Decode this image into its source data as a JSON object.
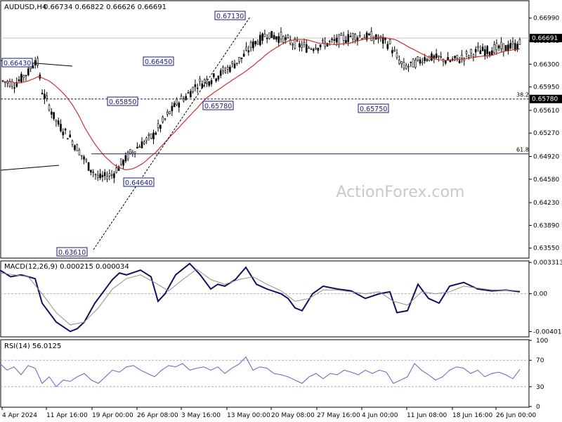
{
  "chart_data": [
    {
      "panel": "price",
      "type": "candlestick",
      "symbol": "AUDUSD,H4",
      "ohlc_text": "0.66734 0.66822 0.66626 0.66691",
      "watermark": "ActionForex.com",
      "ylim": [
        0.634,
        0.6725
      ],
      "y_ticks": [
        0.6635,
        0.6389,
        0.6423,
        0.6458,
        0.6492,
        0.6527,
        0.6561,
        0.6596,
        0.663,
        0.6665,
        0.6699
      ],
      "y_tick_labels": [
        "0.63550",
        "0.63890",
        "0.64230",
        "0.64580",
        "0.64920",
        "0.65270",
        "0.65610",
        "0.65950",
        "0.66300",
        "0.66640",
        "0.66990"
      ],
      "current_price": 0.66691,
      "current_price_label": "0.66691",
      "series": [
        {
          "name": "",
          "x": [
            0,
            20,
            40,
            52,
            60,
            80,
            100,
            125,
            140,
            160,
            180,
            200,
            215,
            230,
            250,
            265,
            280,
            300,
            320,
            345,
            360,
            380,
            400,
            420,
            440,
            460,
            480,
            500,
            520,
            540,
            555,
            565,
            575,
            590,
            605,
            620,
            640,
            660,
            680,
            700,
            720,
            740
          ],
          "y": [
            0.6606,
            0.66,
            0.6618,
            0.664,
            0.659,
            0.6545,
            0.652,
            0.648,
            0.646,
            0.6465,
            0.649,
            0.651,
            0.652,
            0.654,
            0.657,
            0.6582,
            0.66,
            0.6608,
            0.662,
            0.664,
            0.666,
            0.6675,
            0.667,
            0.666,
            0.6655,
            0.666,
            0.6665,
            0.6672,
            0.6672,
            0.6668,
            0.666,
            0.664,
            0.6625,
            0.663,
            0.664,
            0.664,
            0.6635,
            0.664,
            0.665,
            0.6652,
            0.6655,
            0.666
          ]
        }
      ],
      "moving_average": {
        "name": "",
        "color": "#d03030"
      },
      "labels": [
        {
          "text": "0.66430",
          "value": 0.6643
        },
        {
          "text": "0.66450",
          "value": 0.6645
        },
        {
          "text": "0.67130",
          "value": 0.6713
        },
        {
          "text": "0.65850",
          "value": 0.6585
        },
        {
          "text": "0.65780",
          "value": 0.6578
        },
        {
          "text": "0.65750",
          "value": 0.6575
        },
        {
          "text": "0.64640",
          "value": 0.6464
        },
        {
          "text": "0.63610",
          "value": 0.6361
        }
      ],
      "fib_levels": [
        {
          "text": "38.2",
          "value": 0.6578,
          "label": "0.65780"
        },
        {
          "text": "61.8",
          "value": 0.6496
        }
      ]
    },
    {
      "panel": "macd",
      "type": "line",
      "title": "MACD(12,26,9) 0.000215 0.000034",
      "ylim": [
        -0.0045,
        0.0034
      ],
      "y_tick_labels": [
        "0.003313",
        "0.00",
        "-0.004016"
      ],
      "y_ticks": [
        0.003313,
        0.0,
        -0.004016
      ],
      "series": [
        {
          "name": "",
          "color": "#101060",
          "x": [
            0,
            15,
            30,
            50,
            60,
            70,
            80,
            90,
            100,
            110,
            120,
            135,
            150,
            160,
            170,
            180,
            200,
            215,
            225,
            235,
            250,
            270,
            285,
            300,
            310,
            320,
            335,
            350,
            365,
            380,
            400,
            410,
            420,
            430,
            445,
            460,
            480,
            500,
            520,
            540,
            555,
            565,
            580,
            595,
            610,
            625,
            640,
            660,
            680,
            700,
            720,
            740
          ],
          "y": [
            0.0025,
            0.0018,
            0.002,
            0.0016,
            -0.001,
            -0.002,
            -0.003,
            -0.0035,
            -0.004,
            -0.0037,
            -0.003,
            -0.001,
            0.0005,
            0.0015,
            0.0022,
            0.002,
            0.0025,
            0.0018,
            -0.0008,
            0.0,
            0.002,
            0.0032,
            0.002,
            0.0005,
            0.001,
            0.0008,
            0.0015,
            0.0028,
            0.001,
            0.0005,
            0.0,
            -0.0005,
            -0.0015,
            -0.0018,
            0.0,
            0.0008,
            0.0005,
            0.0003,
            -0.0005,
            0.0,
            0.0002,
            -0.002,
            -0.0018,
            0.001,
            -0.0005,
            -0.001,
            0.0008,
            0.0012,
            0.0005,
            0.0003,
            0.0004,
            0.0002
          ]
        },
        {
          "name": "",
          "color": "#909090",
          "x": [
            0,
            20,
            40,
            60,
            80,
            100,
            120,
            140,
            160,
            180,
            200,
            220,
            240,
            260,
            280,
            300,
            320,
            340,
            360,
            380,
            400,
            420,
            440,
            460,
            480,
            500,
            520,
            540,
            560,
            580,
            600,
            620,
            640,
            660,
            680,
            700,
            720,
            740
          ],
          "y": [
            0.0022,
            0.002,
            0.0018,
            0.0,
            -0.002,
            -0.0033,
            -0.003,
            -0.0015,
            0.0005,
            0.0016,
            0.002,
            0.0012,
            0.0003,
            0.0015,
            0.0026,
            0.0015,
            0.001,
            0.0015,
            0.0018,
            0.001,
            0.0003,
            -0.0008,
            -0.0005,
            0.0004,
            0.0004,
            0.0002,
            0.0,
            0.0002,
            -0.0008,
            -0.0012,
            0.0002,
            0.0,
            0.0002,
            0.0008,
            0.0006,
            0.0004,
            0.0004,
            0.0003
          ]
        }
      ]
    },
    {
      "panel": "rsi",
      "type": "line",
      "title": "RSI(14) 56.0125",
      "ylim": [
        0,
        100
      ],
      "y_tick_labels": [
        "100",
        "70",
        "30",
        "0"
      ],
      "y_ticks": [
        100,
        70,
        30,
        0
      ],
      "series": [
        {
          "name": "",
          "color": "#6060c8",
          "x": [
            0,
            10,
            20,
            30,
            40,
            50,
            60,
            70,
            80,
            90,
            100,
            110,
            120,
            130,
            140,
            150,
            160,
            170,
            180,
            190,
            200,
            210,
            220,
            230,
            240,
            250,
            260,
            270,
            280,
            290,
            300,
            310,
            320,
            330,
            340,
            350,
            360,
            370,
            380,
            390,
            400,
            410,
            420,
            430,
            440,
            450,
            460,
            470,
            480,
            490,
            500,
            510,
            520,
            530,
            540,
            550,
            560,
            570,
            580,
            590,
            600,
            610,
            620,
            630,
            640,
            650,
            660,
            670,
            680,
            690,
            700,
            710,
            720,
            730,
            740
          ],
          "y": [
            65,
            55,
            60,
            48,
            62,
            58,
            35,
            45,
            30,
            40,
            38,
            45,
            50,
            40,
            35,
            45,
            55,
            52,
            60,
            62,
            55,
            50,
            45,
            55,
            62,
            60,
            65,
            55,
            58,
            60,
            55,
            60,
            50,
            58,
            64,
            75,
            55,
            60,
            58,
            50,
            48,
            45,
            40,
            35,
            45,
            50,
            42,
            50,
            48,
            55,
            52,
            48,
            55,
            50,
            55,
            52,
            35,
            40,
            45,
            65,
            55,
            48,
            40,
            45,
            55,
            60,
            58,
            50,
            55,
            45,
            50,
            52,
            48,
            42,
            56
          ]
        }
      ]
    }
  ],
  "x_axis": {
    "labels": [
      "4 Apr 2024",
      "11 Apr 16:00",
      "19 Apr 00:00",
      "26 Apr 08:00",
      "3 May 16:00",
      "13 May 00:00",
      "20 May 08:00",
      "27 May 16:00",
      "4 Jun 00:00",
      "11 Jun 08:00",
      "18 Jun 16:00",
      "26 Jun 00:00"
    ]
  },
  "colors": {
    "candle": "#000000",
    "ma": "#d03030",
    "grid": "#c8c8c8",
    "macd": "#101060",
    "signal": "#909090",
    "rsi": "#6060c8"
  }
}
